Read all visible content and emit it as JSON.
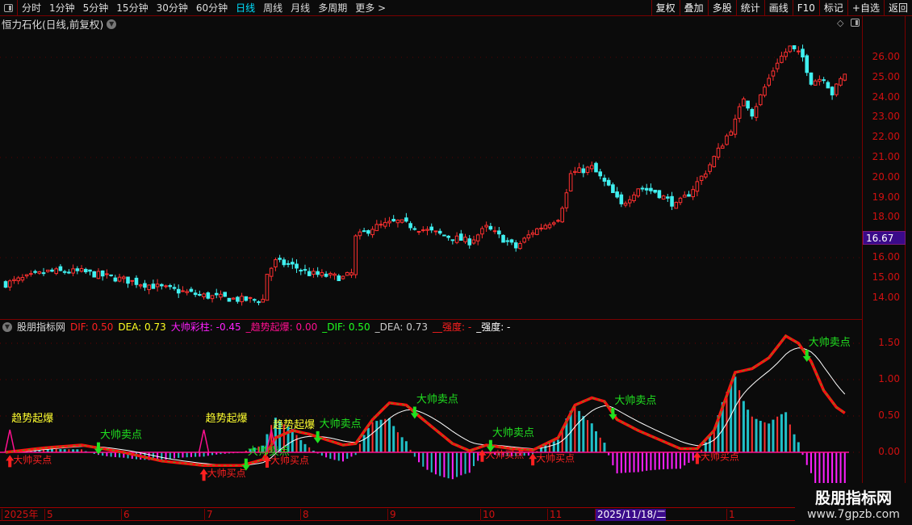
{
  "toolbar": {
    "periods": [
      "分时",
      "1分钟",
      "5分钟",
      "15分钟",
      "30分钟",
      "60分钟",
      "日线",
      "周线",
      "月线",
      "多周期",
      "更多 >"
    ],
    "active_period": "日线",
    "buttons": [
      "复权",
      "叠加",
      "多股",
      "统计",
      "画线",
      "F10",
      "标记",
      "+自选",
      "返回"
    ]
  },
  "stock": {
    "title": "恒力石化(日线,前复权)",
    "current_price": "16.67"
  },
  "price_axis": [
    "26.00",
    "25.00",
    "24.00",
    "23.00",
    "22.00",
    "21.00",
    "20.00",
    "19.00",
    "18.00",
    "16.00",
    "15.00",
    "14.00"
  ],
  "indicator": {
    "name": "股朋指标网",
    "values": [
      {
        "text": "DIF: 0.50",
        "color": "#ff2020"
      },
      {
        "text": "DEA: 0.73",
        "color": "#ffff20"
      },
      {
        "text": "大帅彩柱: -0.45",
        "color": "#ff20ff"
      },
      {
        "text": "_趋势起爆: 0.00",
        "color": "#ff1090"
      },
      {
        "text": "_DIF: 0.50",
        "color": "#20ff20"
      },
      {
        "text": "_DEA: 0.73",
        "color": "#cccccc"
      },
      {
        "text": "__强度: -",
        "color": "#ff2020"
      },
      {
        "text": "_强度: -",
        "color": "#ffffff"
      }
    ],
    "axis": [
      "1.50",
      "1.00",
      "0.50",
      "0.00"
    ],
    "labels": {
      "buy": "大帅买点",
      "sell": "大帅卖点",
      "burst": "趋势起爆"
    }
  },
  "time_axis": [
    "2025年",
    "5",
    "6",
    "7",
    "8",
    "9",
    "10",
    "11",
    "2025/11/18/二",
    "1"
  ],
  "watermark": {
    "title": "股朋指标网",
    "url": "www.7gpzb.com"
  },
  "colors": {
    "up": "#ff3030",
    "down": "#40f0f0",
    "macd_pos": "#20c0c8",
    "macd_neg": "#ff20ff",
    "dif": "#ff1010",
    "dea": "#ffffff",
    "buy": "#ff2020",
    "sell": "#20e020",
    "burst": "#ffff30"
  },
  "chart_data": {
    "type": "candlestick",
    "bars": 200,
    "close_keypoints": [
      [
        0,
        14.7
      ],
      [
        10,
        15.3
      ],
      [
        18,
        15.3
      ],
      [
        28,
        14.9
      ],
      [
        37,
        14.5
      ],
      [
        47,
        14.1
      ],
      [
        56,
        13.9
      ],
      [
        61,
        13.9
      ],
      [
        62,
        15.2
      ],
      [
        64,
        15.8
      ],
      [
        68,
        15.6
      ],
      [
        72,
        15.2
      ],
      [
        80,
        15.0
      ],
      [
        82,
        15.2
      ],
      [
        83,
        17.0
      ],
      [
        87,
        17.5
      ],
      [
        93,
        17.8
      ],
      [
        99,
        17.4
      ],
      [
        106,
        17.0
      ],
      [
        110,
        16.8
      ],
      [
        114,
        17.5
      ],
      [
        121,
        16.5
      ],
      [
        125,
        17.3
      ],
      [
        131,
        18.0
      ],
      [
        133,
        19.2
      ],
      [
        134,
        20.2
      ],
      [
        139,
        20.5
      ],
      [
        143,
        19.5
      ],
      [
        146,
        18.6
      ],
      [
        150,
        19.5
      ],
      [
        154,
        19.3
      ],
      [
        159,
        18.6
      ],
      [
        162,
        19.2
      ],
      [
        166,
        20.3
      ],
      [
        170,
        21.7
      ],
      [
        173,
        22.8
      ],
      [
        175,
        24.0
      ],
      [
        177,
        23.2
      ],
      [
        180,
        24.5
      ],
      [
        183,
        25.8
      ],
      [
        186,
        26.5
      ],
      [
        189,
        26.0
      ],
      [
        191,
        24.8
      ],
      [
        194,
        25.0
      ],
      [
        196,
        24.2
      ],
      [
        199,
        25.2
      ]
    ],
    "dif_keypoints": [
      [
        0,
        0.0
      ],
      [
        9,
        0.06
      ],
      [
        18,
        0.1
      ],
      [
        28,
        0.0
      ],
      [
        37,
        -0.12
      ],
      [
        47,
        -0.18
      ],
      [
        56,
        -0.18
      ],
      [
        61,
        -0.1
      ],
      [
        64,
        0.2
      ],
      [
        68,
        0.3
      ],
      [
        72,
        0.25
      ],
      [
        80,
        0.1
      ],
      [
        83,
        0.12
      ],
      [
        87,
        0.45
      ],
      [
        91,
        0.68
      ],
      [
        95,
        0.65
      ],
      [
        99,
        0.45
      ],
      [
        106,
        0.12
      ],
      [
        110,
        0.02
      ],
      [
        114,
        0.1
      ],
      [
        120,
        0.05
      ],
      [
        125,
        0.03
      ],
      [
        131,
        0.2
      ],
      [
        135,
        0.65
      ],
      [
        139,
        0.75
      ],
      [
        142,
        0.7
      ],
      [
        145,
        0.45
      ],
      [
        150,
        0.3
      ],
      [
        156,
        0.15
      ],
      [
        160,
        0.05
      ],
      [
        164,
        0.05
      ],
      [
        168,
        0.3
      ],
      [
        173,
        1.1
      ],
      [
        177,
        1.15
      ],
      [
        181,
        1.3
      ],
      [
        185,
        1.6
      ],
      [
        188,
        1.5
      ],
      [
        191,
        1.25
      ],
      [
        194,
        0.85
      ],
      [
        197,
        0.62
      ],
      [
        200,
        0.5
      ]
    ],
    "signals": [
      {
        "bar": 1,
        "type": "buy"
      },
      {
        "bar": 22,
        "type": "sell"
      },
      {
        "bar": 47,
        "type": "buy"
      },
      {
        "bar": 57,
        "type": "sell"
      },
      {
        "bar": 62,
        "type": "buy"
      },
      {
        "bar": 74,
        "type": "sell"
      },
      {
        "bar": 97,
        "type": "sell"
      },
      {
        "bar": 113,
        "type": "buy"
      },
      {
        "bar": 115,
        "type": "sell"
      },
      {
        "bar": 125,
        "type": "buy"
      },
      {
        "bar": 144,
        "type": "sell"
      },
      {
        "bar": 164,
        "type": "buy"
      },
      {
        "bar": 190,
        "type": "sell"
      },
      {
        "bar": 1,
        "type": "burst"
      },
      {
        "bar": 47,
        "type": "burst"
      },
      {
        "bar": 63,
        "type": "burst"
      }
    ]
  }
}
